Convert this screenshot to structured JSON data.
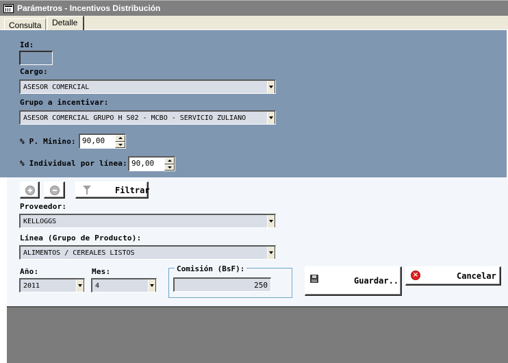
{
  "window": {
    "title": "Parámetros - Incentivos Distribución",
    "icon": "calculator-icon"
  },
  "tabs": [
    {
      "label": "Consulta",
      "active": false
    },
    {
      "label": "Detalle",
      "active": true
    }
  ],
  "form": {
    "id_label": "Id:",
    "id_value": "",
    "cargo_label": "Cargo:",
    "cargo_value": "ASESOR COMERCIAL",
    "grupo_label": "Grupo a incentivar:",
    "grupo_value": "ASESOR COMERCIAL GRUPO H S02 - MCBO - SERVICIO ZULIANO",
    "p_minino_label": "% P. Minino:",
    "p_minino_value": "90,00",
    "individual_label": "% Individual por línea:",
    "individual_value": "90,00"
  },
  "filter": {
    "add_icon": "plus-circle-icon",
    "remove_icon": "minus-circle-icon",
    "filtrar_label": "Filtrar",
    "filtrar_icon": "funnel-icon",
    "proveedor_label": "Proveedor:",
    "proveedor_value": "KELLOGGS",
    "linea_label": "Línea (Grupo de Producto):",
    "linea_value": "ALIMENTOS / CEREALES LISTOS",
    "anio_label": "Año:",
    "anio_value": "2011",
    "mes_label": "Mes:",
    "mes_value": "4",
    "comision_label": "Comisión (BsF):",
    "comision_value": "250",
    "guardar_label": "Guardar..",
    "guardar_icon": "floppy-disk-icon",
    "cancelar_label": "Cancelar",
    "cancelar_icon": "cancel-x-icon"
  },
  "colors": {
    "upper_panel": "#8097b1",
    "lower_panel": "#f3f7fc",
    "bottom_area": "#7c7c7c",
    "titlebar": "#808080"
  }
}
